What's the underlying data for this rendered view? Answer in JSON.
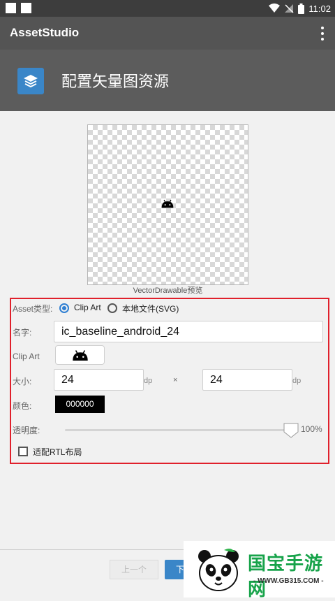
{
  "status_bar": {
    "time": "11:02"
  },
  "app_bar": {
    "title": "AssetStudio"
  },
  "header": {
    "title": "配置矢量图资源"
  },
  "preview": {
    "caption": "VectorDrawable预览"
  },
  "form": {
    "asset_type_label": "Asset类型:",
    "radio_clip_art": "Clip Art",
    "radio_local_svg": "本地文件(SVG)",
    "name_label": "名字:",
    "name_value": "ic_baseline_android_24",
    "clip_art_label": "Clip Art",
    "clip_art_icon": "android-icon",
    "size_label": "大小:",
    "width_value": "24",
    "width_unit": "dp",
    "times": "×",
    "height_value": "24",
    "height_unit": "dp",
    "color_label": "颜色:",
    "color_value": "000000",
    "opacity_label": "透明度:",
    "opacity_value": "100%",
    "opacity_fraction": 1.0,
    "rtl_label": "适配RTL布局",
    "rtl_checked": false,
    "selected_type": "Clip Art"
  },
  "nav": {
    "prev_label": "上一个",
    "next_label": "下"
  },
  "watermark": {
    "title": "国宝手游网",
    "url": "- WWW.GB315.COM -"
  },
  "colors": {
    "accent": "#3a86c8",
    "highlight_border": "#e0202b",
    "app_bar": "#545454",
    "header": "#5c5c5c",
    "watermark_green": "#17a34a"
  }
}
